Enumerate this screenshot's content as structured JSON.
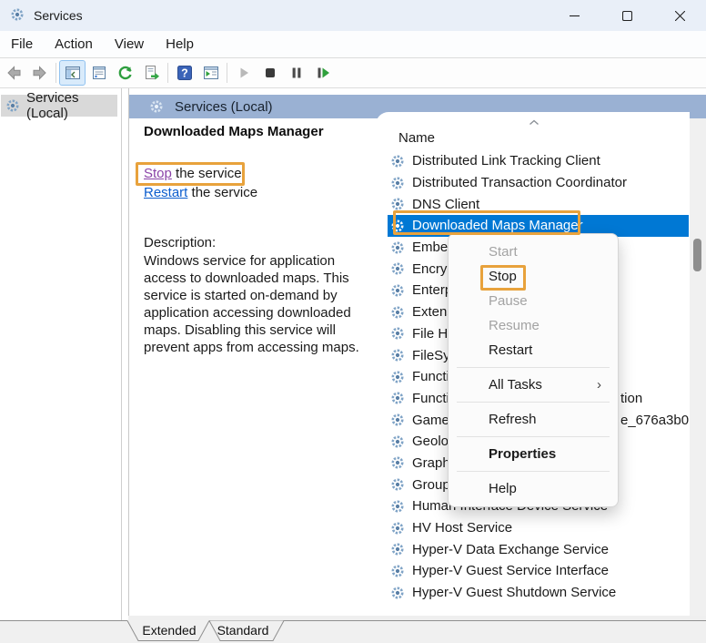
{
  "window": {
    "title": "Services",
    "control_icons": [
      "minimize-icon",
      "maximize-icon",
      "close-icon"
    ]
  },
  "menu_bar": [
    "File",
    "Action",
    "View",
    "Help"
  ],
  "toolbar": {
    "icons": [
      "back",
      "forward",
      "show-console-tree",
      "properties",
      "refresh",
      "export-list",
      "help",
      "show-extended-view",
      "start-service",
      "stop-service",
      "pause-service",
      "restart-service"
    ]
  },
  "tree": {
    "item": "Services (Local)"
  },
  "main": {
    "header": "Services (Local)",
    "extended_pane": {
      "service_title": "Downloaded Maps Manager",
      "stop_link": "Stop",
      "stop_suffix": " the service",
      "restart_link": "Restart",
      "restart_suffix": " the service",
      "description_label": "Description:",
      "description": "Windows service for application access to downloaded maps. This service is started on-demand by application accessing downloaded maps. Disabling this service will prevent apps from accessing maps."
    },
    "list": {
      "column": "Name",
      "sort_icon": "chevron-up",
      "rows": [
        {
          "label": "Distributed Link Tracking Client"
        },
        {
          "label": "Distributed Transaction Coordinator"
        },
        {
          "label": "DNS Client"
        },
        {
          "label": "Downloaded Maps Manager",
          "selected": true
        },
        {
          "label": "Embedd"
        },
        {
          "label": "Encrypt"
        },
        {
          "label": "Enterpr"
        },
        {
          "label": "Extensi"
        },
        {
          "label": "File His"
        },
        {
          "label": "FileSyn"
        },
        {
          "label": "Functio"
        },
        {
          "label": "Functio",
          "fragment": "tion"
        },
        {
          "label": "GameD",
          "fragment": "e_676a3b0"
        },
        {
          "label": "Geoloc"
        },
        {
          "label": "Graphi"
        },
        {
          "label": "Group"
        },
        {
          "label": "Human Interface Device Service"
        },
        {
          "label": "HV Host Service"
        },
        {
          "label": "Hyper-V Data Exchange Service"
        },
        {
          "label": "Hyper-V Guest Service Interface"
        },
        {
          "label": "Hyper-V Guest Shutdown Service"
        }
      ]
    }
  },
  "context_menu": {
    "submenu_arrow": "›",
    "items": [
      {
        "label": "Start",
        "enabled": false
      },
      {
        "label": "Stop",
        "enabled": true
      },
      {
        "label": "Pause",
        "enabled": false
      },
      {
        "label": "Resume",
        "enabled": false
      },
      {
        "label": "Restart",
        "enabled": true,
        "separator_after": true
      },
      {
        "label": "All Tasks",
        "enabled": true,
        "submenu": true,
        "separator_after": true
      },
      {
        "label": "Refresh",
        "enabled": true,
        "separator_after": true
      },
      {
        "label": "Properties",
        "enabled": true,
        "bold": true,
        "separator_after": true
      },
      {
        "label": "Help",
        "enabled": true
      }
    ]
  },
  "tabs": {
    "extended": "Extended",
    "standard": "Standard"
  },
  "colors": {
    "annotation": "#E8A23C",
    "selection": "#0078D4",
    "panel_header": "#9AB1D3",
    "titlebar": "#E9EFF8",
    "link": "#0B5DCE",
    "visited_link": "#8A43A8",
    "disabled_text": "#A3A3A3"
  }
}
